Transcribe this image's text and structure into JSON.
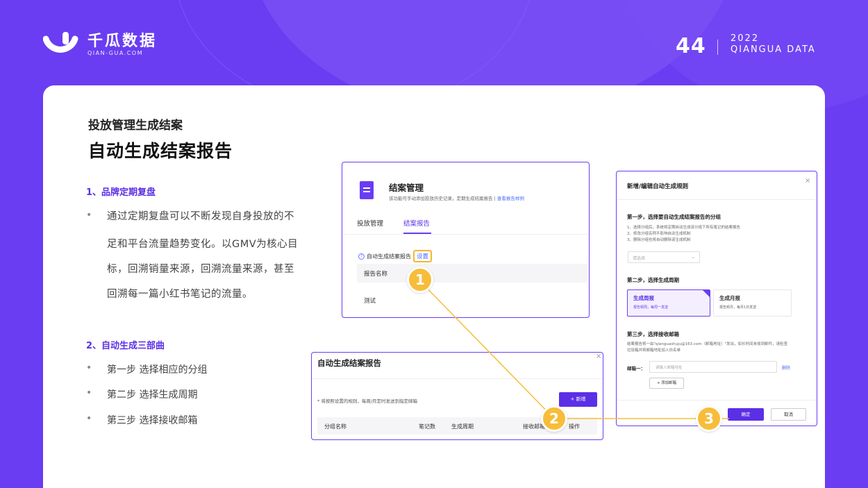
{
  "brand": {
    "name": "千瓜数据",
    "domain": "QIAN-GUA.COM"
  },
  "page": {
    "number": "44",
    "year": "2022",
    "tagline": "QIANGUA DATA"
  },
  "content": {
    "kicker": "投放管理生成结案",
    "title": "自动生成结案报告",
    "section1": {
      "title": "1、品牌定期复盘",
      "lines": [
        "通过定期复盘可以不断发现自身投放的不",
        "足和平台流量趋势变化。以GMV为核心目",
        "标，回溯销量来源，回溯流量来源，甚至",
        "回溯每一篇小红书笔记的流量。"
      ]
    },
    "section2": {
      "title": "2、自动生成三部曲",
      "bullets": [
        "第一步 选择相应的分组",
        "第二步 选择生成周期",
        "第三步 选择接收邮箱"
      ]
    }
  },
  "panel_manage": {
    "title": "结案管理",
    "subtitle": "该功能可手动添加投放历史记录，定期生成结案报告 | ",
    "subtitle_link": "查看报告样例",
    "tabs": [
      "投放管理",
      "结案报告"
    ],
    "auto_label": "自动生成结案报告",
    "settings_link": "设置",
    "column_header": "报告名称",
    "row_value": "测试"
  },
  "panel_auto": {
    "title": "自动生成结案报告",
    "close": "×",
    "note": "* 将按照设置的规则，每周/月定时发送到指定邮箱",
    "add_button": "+ 新增",
    "columns": [
      "分组名称",
      "笔记数",
      "生成周期",
      "接收邮箱",
      "操作"
    ]
  },
  "panel_rule": {
    "title": "新增/编辑自动生成规则",
    "close": "×",
    "step1_title": "第一步，选择要自动生成结案报告的分组",
    "step1_notes": [
      "1、选择分组后，系统将定期自动生成该分组下所有笔记的结案报告",
      "2、修改分组名称不影响自动生成机制",
      "3、删除分组也将自动删除该生成机制"
    ],
    "select_placeholder": "请选择",
    "step2_title": "第二步，选择生成周期",
    "weekly": {
      "title": "生成周报",
      "desc": "报告频周，每周一发送"
    },
    "monthly": {
      "title": "生成月报",
      "desc": "报告频月，每月1日发送"
    },
    "step3_title": "第三步，选择接收邮箱",
    "step3_notes": [
      "结案报告将一由\"qianguashuju@163.com（邮箱地址）\"发出，如长时间未收到邮件，请检查",
      "垃圾箱并将邮箱地址加入白名单"
    ],
    "mail_label": "邮箱一：",
    "mail_placeholder": "请输入邮箱地址",
    "mail_delete": "删除",
    "add_mail": "+ 添加邮箱",
    "confirm": "确定",
    "cancel": "取消"
  },
  "callouts": [
    "1",
    "2",
    "3"
  ],
  "colors": {
    "brand_purple": "#6a3df2",
    "accent_yellow": "#f7bd3a",
    "link_blue": "#4a6cf7"
  }
}
